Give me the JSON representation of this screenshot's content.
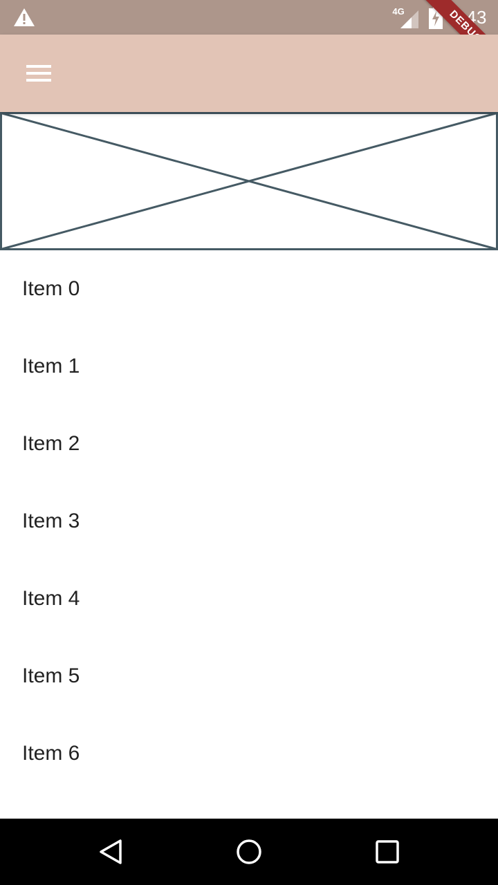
{
  "status_bar": {
    "network_type": "4G",
    "time": "8:43",
    "debug_banner": "DEBUG"
  },
  "app_bar": {
    "menu_icon": "hamburger-menu-icon",
    "background": "#e2c4b6"
  },
  "placeholder": {
    "stroke": "#455a64"
  },
  "list": {
    "items": [
      {
        "label": "Item 0"
      },
      {
        "label": "Item 1"
      },
      {
        "label": "Item 2"
      },
      {
        "label": "Item 3"
      },
      {
        "label": "Item 4"
      },
      {
        "label": "Item 5"
      },
      {
        "label": "Item 6"
      }
    ]
  },
  "nav_bar": {
    "buttons": [
      "back-triangle-icon",
      "home-circle-icon",
      "recents-square-icon"
    ]
  }
}
